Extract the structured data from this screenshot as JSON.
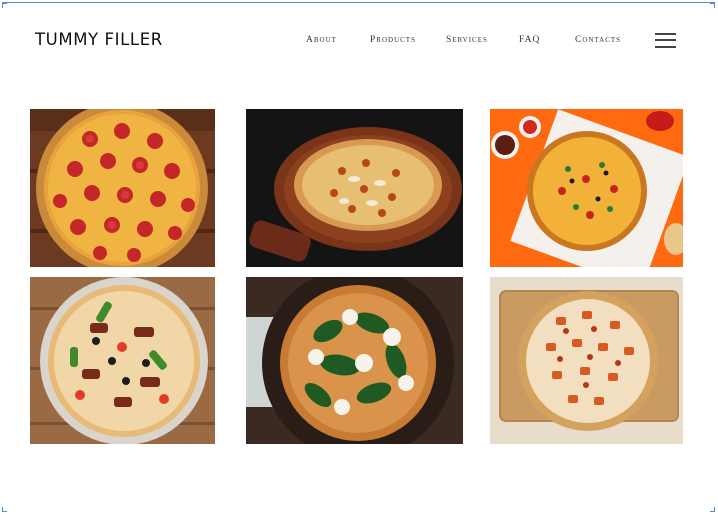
{
  "brand": {
    "logo": "TUMMY FILLER"
  },
  "nav": {
    "items": [
      {
        "label": "About"
      },
      {
        "label": "Products"
      },
      {
        "label": "Services"
      },
      {
        "label": "FAQ"
      },
      {
        "label": "Contacts"
      }
    ],
    "menu_icon": "hamburger-icon"
  },
  "gallery": {
    "photos": [
      {
        "subject": "pepperoni-pizza",
        "background": "#6b3a20"
      },
      {
        "subject": "pizza-on-wooden-board",
        "background": "#141414"
      },
      {
        "subject": "pizza-on-orange-table",
        "background": "#ff6a10"
      },
      {
        "subject": "vegetable-pizza",
        "background": "#9a6a44"
      },
      {
        "subject": "spinach-mozzarella-pizza",
        "background": "#3a2a22"
      },
      {
        "subject": "chicken-pizza-on-cutting-board",
        "background": "#e8dccb"
      }
    ]
  }
}
